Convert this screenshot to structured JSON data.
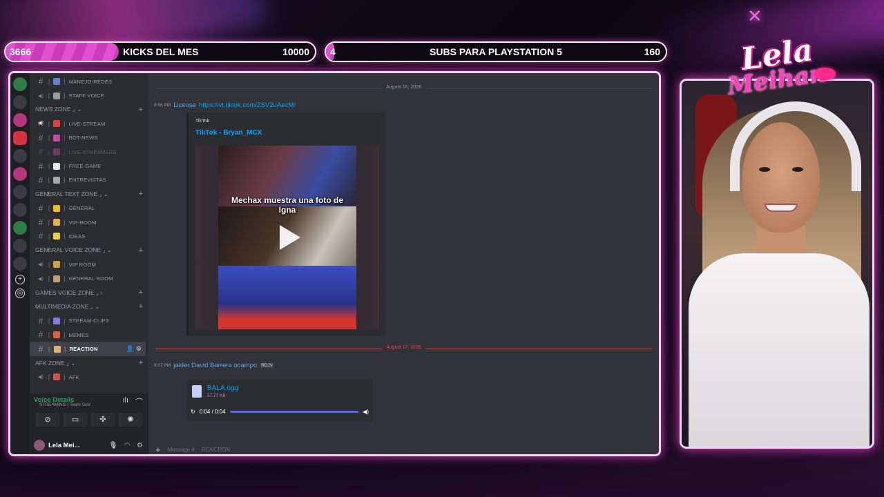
{
  "overlay": {
    "goal_kicks": {
      "current": "3666",
      "title": "KICKS DEL MES",
      "target": "10000",
      "progress": 0.3666
    },
    "goal_subs": {
      "current": "4",
      "title": "SUBS PARA PLAYSTATION 5",
      "target": "160",
      "progress": 0.025
    },
    "logo": {
      "line1": "Lela",
      "line2": "Meihan"
    },
    "accent_color": "#e24fd0"
  },
  "channels": {
    "items": [
      {
        "type": "channel",
        "icon": "hash-icon",
        "label": "MANEJO-REDES"
      },
      {
        "type": "channel",
        "icon": "voice-icon",
        "label": "STAFF VOICE"
      },
      {
        "type": "category",
        "label": "NEWS ZONE ⌟ ⌄"
      },
      {
        "type": "channel",
        "icon": "announce-icon",
        "label": "LIVE-STREAM"
      },
      {
        "type": "channel",
        "icon": "hash-icon",
        "label": "BOT-NEWS"
      },
      {
        "type": "channel",
        "icon": "hash-icon",
        "label": "LIVE-STREAMERS",
        "muted": true
      },
      {
        "type": "channel",
        "icon": "hash-icon",
        "label": "FREE-GAME"
      },
      {
        "type": "channel",
        "icon": "hash-icon",
        "label": "ENTREVISTAS"
      },
      {
        "type": "category",
        "label": "GENERAL TEXT ZONE ⌟ ⌄"
      },
      {
        "type": "channel",
        "icon": "hash-icon",
        "label": "GENERAL"
      },
      {
        "type": "channel",
        "icon": "hash-icon",
        "label": "VIP-ROOM"
      },
      {
        "type": "channel",
        "icon": "hash-icon",
        "label": "IDEAS"
      },
      {
        "type": "category",
        "label": "GENERAL VOICE ZONE ⌟ ⌄"
      },
      {
        "type": "channel",
        "icon": "voice-icon",
        "label": "VIP ROOM"
      },
      {
        "type": "channel",
        "icon": "voice-icon",
        "label": "GENERAL ROOM"
      },
      {
        "type": "category",
        "label": "GAMES VOICE ZONE ⌟ ›"
      },
      {
        "type": "category",
        "label": "MULTIMEDIA ZONE ⌟ ⌄"
      },
      {
        "type": "channel",
        "icon": "hash-icon",
        "label": "STREAM-CLIPS"
      },
      {
        "type": "channel",
        "icon": "hash-icon",
        "label": "MEMES"
      },
      {
        "type": "channel",
        "icon": "hash-icon",
        "label": "REACTION",
        "active": true
      },
      {
        "type": "category",
        "label": "AFK ZONE ⌟ ⌄"
      },
      {
        "type": "channel",
        "icon": "voice-icon",
        "label": "AFK"
      }
    ]
  },
  "voice": {
    "title": "Voice Details",
    "sub": "STREAMING / Team SoV"
  },
  "user": {
    "name": "Lela Mei..."
  },
  "chat": {
    "date1": "August 16, 2026",
    "msg1": {
      "time": "8:56 PM",
      "author": "License",
      "link": "https://vt.tiktok.com/ZSV2uAecM/"
    },
    "embed": {
      "provider": "TikTok",
      "title": "TikTok - Bryan_MCX",
      "caption": "Mechax muestra una foto de Igna"
    },
    "date2": "August 17, 2026",
    "msg2": {
      "time": "8:07 PM",
      "author": "jaider David Barrera ocampo",
      "tag": "RDJV"
    },
    "file": {
      "name": "BALA.ogg",
      "size": "57.77 KB",
      "time": "0:04 / 0:04"
    },
    "composer": {
      "placeholder": "Message #",
      "channel": "REACTION"
    }
  }
}
